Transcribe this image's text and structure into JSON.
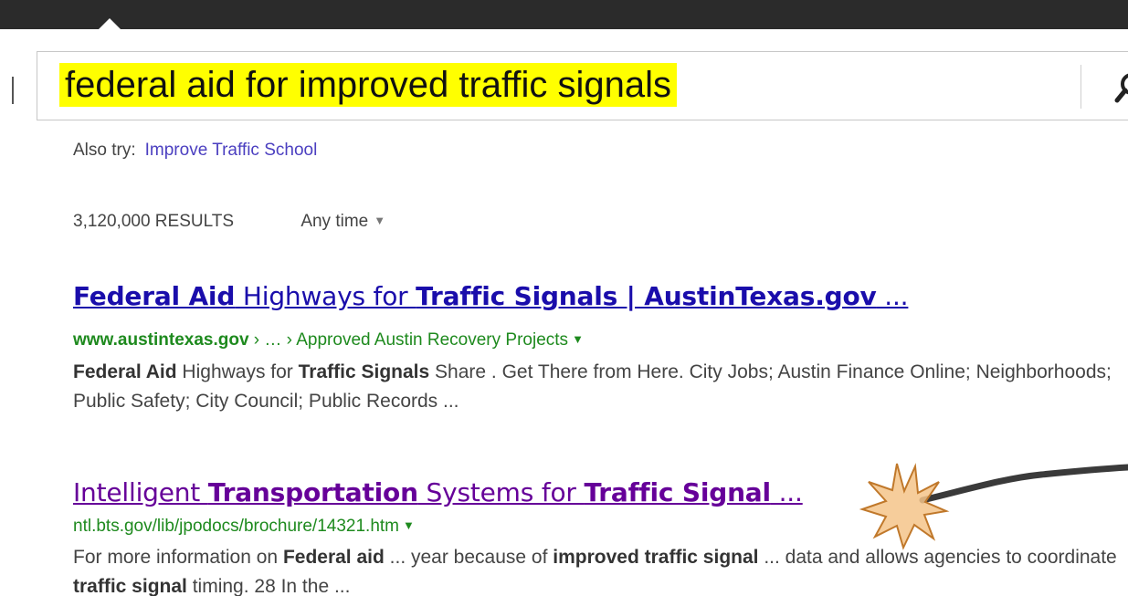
{
  "search": {
    "query": "federal aid for improved traffic signals"
  },
  "also_try": {
    "label": "Also try:",
    "link": "Improve Traffic School"
  },
  "stats": {
    "count": "3,120,000 RESULTS",
    "time_filter": "Any time"
  },
  "icons": {
    "search": "search-icon",
    "caret": "chevron-down-icon",
    "annotation": "starburst-icon"
  },
  "colors": {
    "topbar": "#2b2b2b",
    "highlight": "#ffff00",
    "link_unvisited": "#1a0dab",
    "link_visited": "#660099",
    "url_green": "#1e8a1e",
    "starburst_fill": "#f5c48a",
    "starburst_stroke": "#c0782a"
  },
  "results": [
    {
      "title": {
        "p1": "Federal Aid",
        "p2": " Highways for ",
        "p3": "Traffic Signals | AustinTexas.gov",
        "p4": " ..."
      },
      "url": {
        "domain": "www.austintexas.gov",
        "path": " › … › Approved Austin Recovery Projects"
      },
      "snippet": {
        "s1": "Federal Aid",
        "s2": " Highways for ",
        "s3": "Traffic Signals",
        "s4": " Share . Get There from Here. City Jobs; Austin Finance Online; Neighborhoods; Public Safety; City Council; Public Records ..."
      }
    },
    {
      "title": {
        "p1": "Intelligent ",
        "p2": "Transportation",
        "p3": " Systems for ",
        "p4": "Traffic Signal",
        "p5": " ..."
      },
      "url": {
        "path": "ntl.bts.gov/lib/jpodocs/brochure/14321.htm"
      },
      "snippet": {
        "s1": "For more information on ",
        "s2": "Federal aid",
        "s3": " ... year because of ",
        "s4": "improved traffic signal",
        "s5": " ... data and allows agencies to coordinate ",
        "s6": "traffic signal",
        "s7": " timing. 28 In the ..."
      }
    }
  ]
}
